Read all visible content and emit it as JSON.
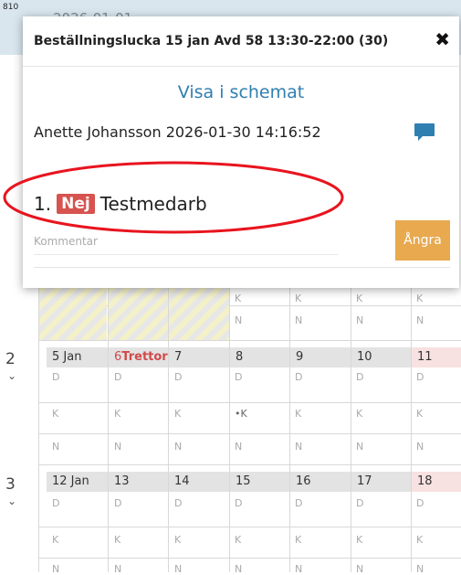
{
  "corner_label": "810",
  "background_date": "2026-01-01",
  "dialog": {
    "title": "Beställningslucka 15 jan Avd 58 13:30-22:00 (30)",
    "close_symbol": "✖",
    "link": "Visa i schemat",
    "user_line": "Anette Johansson 2026-01-30 14:16:52",
    "entry_number": "1.",
    "entry_badge": "Nej",
    "entry_name": "Testmedarb",
    "comment_placeholder": "Kommentar",
    "undo_label": "Ångra"
  },
  "schedule": {
    "partial_row": [
      "K",
      "K",
      "K",
      "K"
    ],
    "partial_row_n": [
      "N",
      "N",
      "N",
      "N"
    ],
    "weeks": [
      {
        "number": "2",
        "days": [
          "5 Jan",
          "6",
          "Trettor",
          "7",
          "8",
          "9",
          "10",
          "11"
        ],
        "rows": [
          [
            "D",
            "D",
            "D",
            "D",
            "D",
            "D",
            "D"
          ],
          [
            "K",
            "K",
            "K",
            "•K",
            "K",
            "K",
            "K"
          ],
          [
            "N",
            "N",
            "N",
            "N",
            "N",
            "N",
            "N"
          ]
        ]
      },
      {
        "number": "3",
        "days": [
          "12 Jan",
          "13",
          "14",
          "15",
          "16",
          "17",
          "18"
        ],
        "rows": [
          [
            "D",
            "D",
            "D",
            "D",
            "D",
            "D",
            "D"
          ],
          [
            "K",
            "K",
            "K",
            "K",
            "K",
            "K",
            "K"
          ],
          [
            "N",
            "N",
            "N",
            "N",
            "N",
            "N",
            "N"
          ]
        ]
      }
    ]
  },
  "colors": {
    "badge": "#d6534f",
    "link": "#2f7fb0",
    "undo": "#e8a94f",
    "highlight": "#e8141e"
  }
}
